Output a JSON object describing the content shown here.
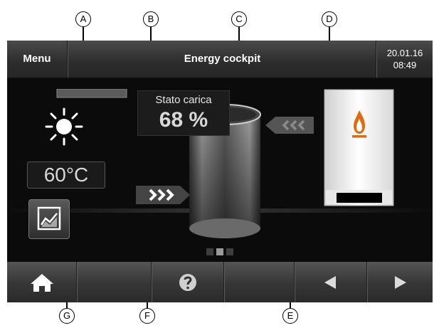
{
  "callouts": [
    "A",
    "B",
    "C",
    "D",
    "E",
    "F",
    "G"
  ],
  "topbar": {
    "menu_label": "Menu",
    "title": "Energy cockpit",
    "date": "20.01.16",
    "time": "08:49"
  },
  "solar": {
    "temperature": "60°C",
    "icon": "sun-icon"
  },
  "storage": {
    "charge_label": "Stato carica",
    "charge_value": "68 %",
    "charge_fraction": 0.68
  },
  "boiler": {
    "icon": "flame-icon"
  },
  "page_indicator": {
    "count": 3,
    "active": 1
  },
  "bottombar": {
    "home_icon": "home-icon",
    "help_icon": "help-icon",
    "prev_icon": "arrow-left-icon",
    "next_icon": "arrow-right-icon"
  },
  "colors": {
    "screen_bg": "#0b0b0b",
    "bar_bg": "#3a3a3a",
    "text": "#ffffff",
    "flame": "#e06a10"
  }
}
